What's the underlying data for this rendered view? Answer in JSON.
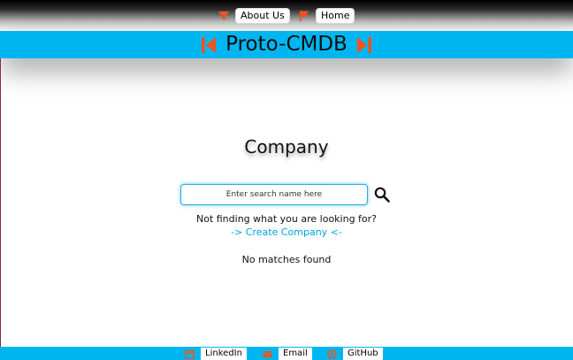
{
  "nav": {
    "about_label": "About Us",
    "home_label": "Home"
  },
  "brand": {
    "title": "Proto-CMDB",
    "left_icon": "skip-back-icon",
    "right_icon": "skip-forward-icon"
  },
  "page": {
    "title": "Company"
  },
  "search": {
    "placeholder": "Enter search name here",
    "value": "",
    "button_icon": "search-icon"
  },
  "messages": {
    "not_finding": "Not finding what you are looking for?",
    "create_link": "-> Create Company <-",
    "no_matches": "No matches found"
  },
  "footer": {
    "linkedin_label": "LinkedIn",
    "email_label": "Email",
    "github_label": "GitHub"
  },
  "colors": {
    "accent_blue": "#00b6f0",
    "icon_orange": "#f4511e",
    "link_blue": "#00a3de"
  }
}
